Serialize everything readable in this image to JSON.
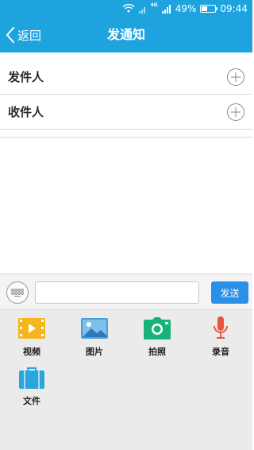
{
  "status_bar": {
    "network": "4G",
    "battery": "49%",
    "battery_level": 0.49,
    "time": "09:44"
  },
  "nav": {
    "back_label": "返回",
    "title": "发通知"
  },
  "form": {
    "sender_label": "发件人",
    "recipient_label": "收件人"
  },
  "input_bar": {
    "message_value": "",
    "send_label": "发送"
  },
  "tools": [
    {
      "label": "视频",
      "icon": "video-icon",
      "color": "#f5b51c"
    },
    {
      "label": "图片",
      "icon": "image-icon",
      "color": "#4a9fd8"
    },
    {
      "label": "拍照",
      "icon": "camera-icon",
      "color": "#17b37b"
    },
    {
      "label": "录音",
      "icon": "microphone-icon",
      "color": "#e8553d"
    },
    {
      "label": "文件",
      "icon": "briefcase-icon",
      "color": "#2aa6dd"
    }
  ],
  "colors": {
    "header": "#1fa3df",
    "send_button": "#2a8fe8",
    "panel_bg": "#ebebeb"
  }
}
